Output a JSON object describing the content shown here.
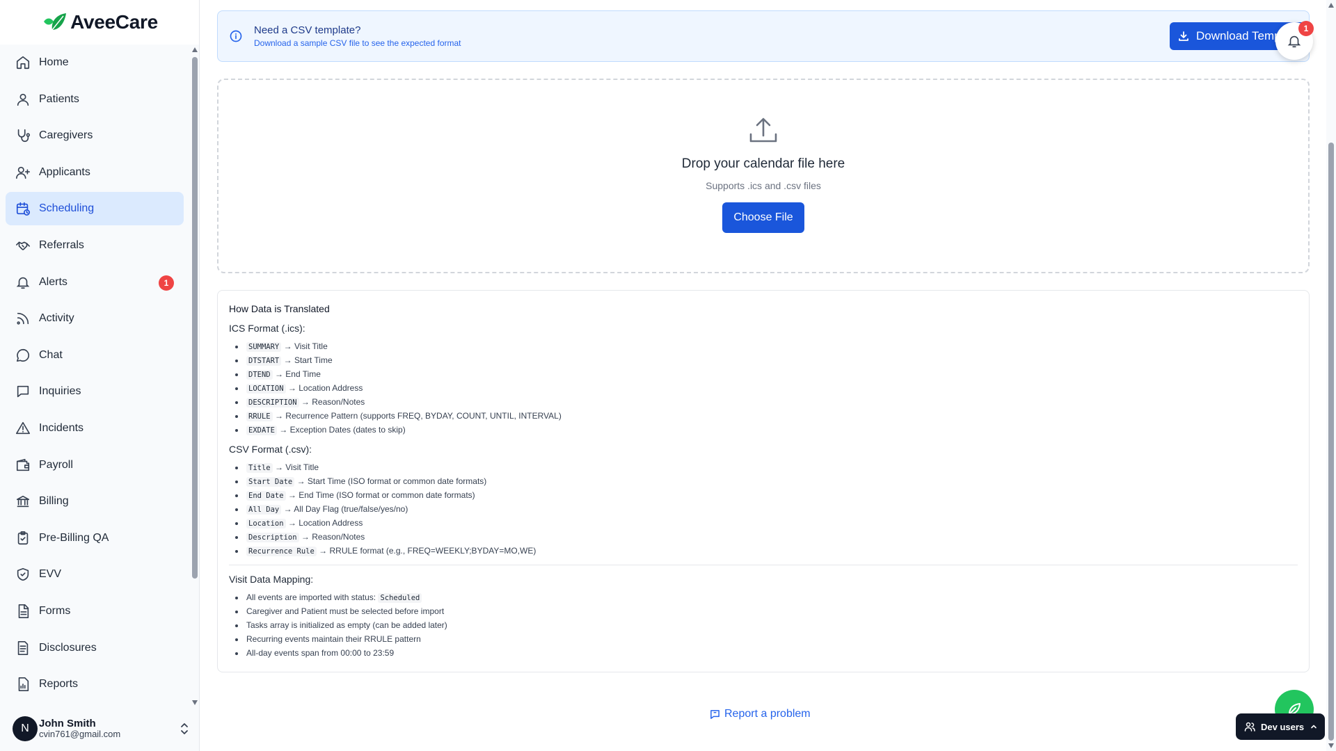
{
  "brand": {
    "name": "AveeCare",
    "accent": "#22c55e"
  },
  "sidebar": {
    "items": [
      {
        "label": "Home",
        "icon": "home-icon"
      },
      {
        "label": "Patients",
        "icon": "user-icon"
      },
      {
        "label": "Caregivers",
        "icon": "stethoscope-icon"
      },
      {
        "label": "Applicants",
        "icon": "user-plus-icon"
      },
      {
        "label": "Scheduling",
        "icon": "calendar-clock-icon",
        "active": true
      },
      {
        "label": "Referrals",
        "icon": "handshake-icon"
      },
      {
        "label": "Alerts",
        "icon": "bell-icon",
        "badge": "1"
      },
      {
        "label": "Activity",
        "icon": "rss-icon"
      },
      {
        "label": "Chat",
        "icon": "chat-bubble-icon"
      },
      {
        "label": "Inquiries",
        "icon": "message-square-icon"
      },
      {
        "label": "Incidents",
        "icon": "warning-triangle-icon"
      },
      {
        "label": "Payroll",
        "icon": "wallet-icon"
      },
      {
        "label": "Billing",
        "icon": "bank-icon"
      },
      {
        "label": "Pre-Billing QA",
        "icon": "clipboard-check-icon"
      },
      {
        "label": "EVV",
        "icon": "shield-check-icon"
      },
      {
        "label": "Forms",
        "icon": "file-text-icon"
      },
      {
        "label": "Disclosures",
        "icon": "file-lines-icon"
      },
      {
        "label": "Reports",
        "icon": "file-chart-icon"
      }
    ]
  },
  "user": {
    "initial": "N",
    "name": "John Smith",
    "email": "cvin761@gmail.com"
  },
  "banner": {
    "title": "Need a CSV template?",
    "subtitle": "Download a sample CSV file to see the expected format",
    "button_label": "Download Template"
  },
  "notifications": {
    "count": "1"
  },
  "dropzone": {
    "title": "Drop your calendar file here",
    "subtitle": "Supports .ics and .csv files",
    "button_label": "Choose File"
  },
  "mapping": {
    "title": "How Data is Translated",
    "ics": {
      "title": "ICS Format (.ics):",
      "rows": [
        {
          "field": "SUMMARY",
          "desc": "→ Visit Title"
        },
        {
          "field": "DTSTART",
          "desc": "→ Start Time"
        },
        {
          "field": "DTEND",
          "desc": "→ End Time"
        },
        {
          "field": "LOCATION",
          "desc": "→ Location Address"
        },
        {
          "field": "DESCRIPTION",
          "desc": "→ Reason/Notes"
        },
        {
          "field": "RRULE",
          "desc": "→ Recurrence Pattern (supports FREQ, BYDAY, COUNT, UNTIL, INTERVAL)"
        },
        {
          "field": "EXDATE",
          "desc": "→ Exception Dates (dates to skip)"
        }
      ]
    },
    "csv": {
      "title": "CSV Format (.csv):",
      "rows": [
        {
          "field": "Title",
          "desc": "→ Visit Title"
        },
        {
          "field": "Start Date",
          "desc": "→ Start Time (ISO format or common date formats)"
        },
        {
          "field": "End Date",
          "desc": "→ End Time (ISO format or common date formats)"
        },
        {
          "field": "All Day",
          "desc": "→ All Day Flag (true/false/yes/no)"
        },
        {
          "field": "Location",
          "desc": "→ Location Address"
        },
        {
          "field": "Description",
          "desc": "→ Reason/Notes"
        },
        {
          "field": "Recurrence Rule",
          "desc": "→ RRULE format (e.g., FREQ=WEEKLY;BYDAY=MO,WE)"
        }
      ]
    },
    "visit": {
      "title": "Visit Data Mapping:",
      "status_prefix": "All events are imported with status:",
      "status_value": "Scheduled",
      "rows": [
        "Caregiver and Patient must be selected before import",
        "Tasks array is initialized as empty (can be added later)",
        "Recurring events maintain their RRULE pattern",
        "All-day events span from 00:00 to 23:59"
      ]
    }
  },
  "footer": {
    "report_label": "Report a problem"
  },
  "dev_users": {
    "label": "Dev users"
  },
  "colors": {
    "primary": "#1a56db",
    "badge": "#ef4444",
    "active_bg": "#dbeafe",
    "fab": "#22c55e"
  }
}
